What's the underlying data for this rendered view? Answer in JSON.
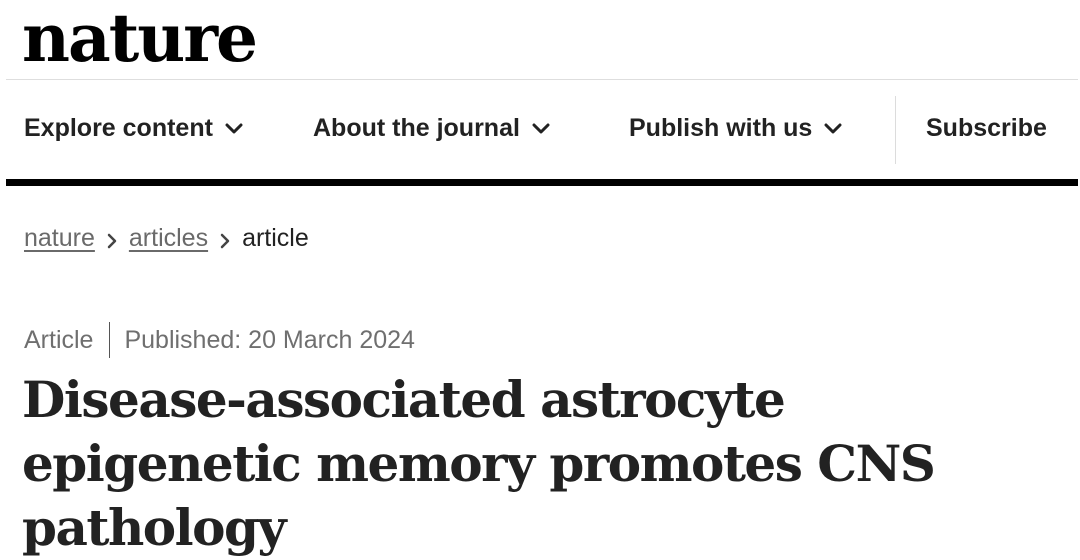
{
  "site": {
    "logo": "nature"
  },
  "nav": {
    "items": [
      {
        "label": "Explore content",
        "has_dropdown": true
      },
      {
        "label": "About the journal",
        "has_dropdown": true
      },
      {
        "label": "Publish with us",
        "has_dropdown": true
      }
    ],
    "subscribe_label": "Subscribe"
  },
  "breadcrumb": {
    "items": [
      {
        "label": "nature",
        "link": true
      },
      {
        "label": "articles",
        "link": true
      },
      {
        "label": "article",
        "link": false
      }
    ],
    "separator_icon": "chevron-right-icon"
  },
  "article": {
    "type": "Article",
    "published": "Published: 20 March 2024",
    "title": "Disease-associated astrocyte epigenetic memory promotes CNS pathology"
  },
  "colors": {
    "text": "#222222",
    "muted": "#6f6f6f",
    "rule": "#000000",
    "divider": "#dedede"
  },
  "icons": {
    "dropdown": "chevron-down-icon"
  }
}
